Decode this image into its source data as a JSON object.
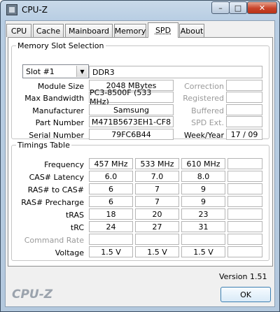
{
  "window": {
    "title": "CPU-Z",
    "minimize": "–",
    "maximize": "□",
    "close": "✕"
  },
  "tabs": [
    "CPU",
    "Cache",
    "Mainboard",
    "Memory",
    "SPD",
    "About"
  ],
  "slot": {
    "legend": "Memory Slot Selection",
    "selected": "Slot #1",
    "type": "DDR3",
    "labels": {
      "module_size": "Module Size",
      "max_bandwidth": "Max Bandwidth",
      "manufacturer": "Manufacturer",
      "part_number": "Part Number",
      "serial_number": "Serial Number",
      "correction": "Correction",
      "registered": "Registered",
      "buffered": "Buffered",
      "spd_ext": "SPD Ext.",
      "week_year": "Week/Year"
    },
    "values": {
      "module_size": "2048 MBytes",
      "max_bandwidth": "PC3-8500F (533 MHz)",
      "manufacturer": "Samsung",
      "part_number": "M471B5673EH1-CF8",
      "serial_number": "79FC6B44",
      "correction": "",
      "registered": "",
      "buffered": "",
      "spd_ext": "",
      "week_year": "17 / 09"
    }
  },
  "timings": {
    "legend": "Timings Table",
    "rows": [
      {
        "label": "Frequency",
        "values": [
          "457 MHz",
          "533 MHz",
          "610 MHz",
          ""
        ]
      },
      {
        "label": "CAS# Latency",
        "values": [
          "6.0",
          "7.0",
          "8.0",
          ""
        ]
      },
      {
        "label": "RAS# to CAS#",
        "values": [
          "6",
          "7",
          "9",
          ""
        ]
      },
      {
        "label": "RAS# Precharge",
        "values": [
          "6",
          "7",
          "9",
          ""
        ]
      },
      {
        "label": "tRAS",
        "values": [
          "18",
          "20",
          "23",
          ""
        ]
      },
      {
        "label": "tRC",
        "values": [
          "24",
          "27",
          "31",
          ""
        ]
      },
      {
        "label": "Command Rate",
        "values": [
          "",
          "",
          "",
          ""
        ]
      },
      {
        "label": "Voltage",
        "values": [
          "1.5 V",
          "1.5 V",
          "1.5 V",
          ""
        ]
      }
    ]
  },
  "footer": {
    "version": "Version 1.51",
    "brand": "CPU-Z",
    "ok_label": "OK"
  }
}
